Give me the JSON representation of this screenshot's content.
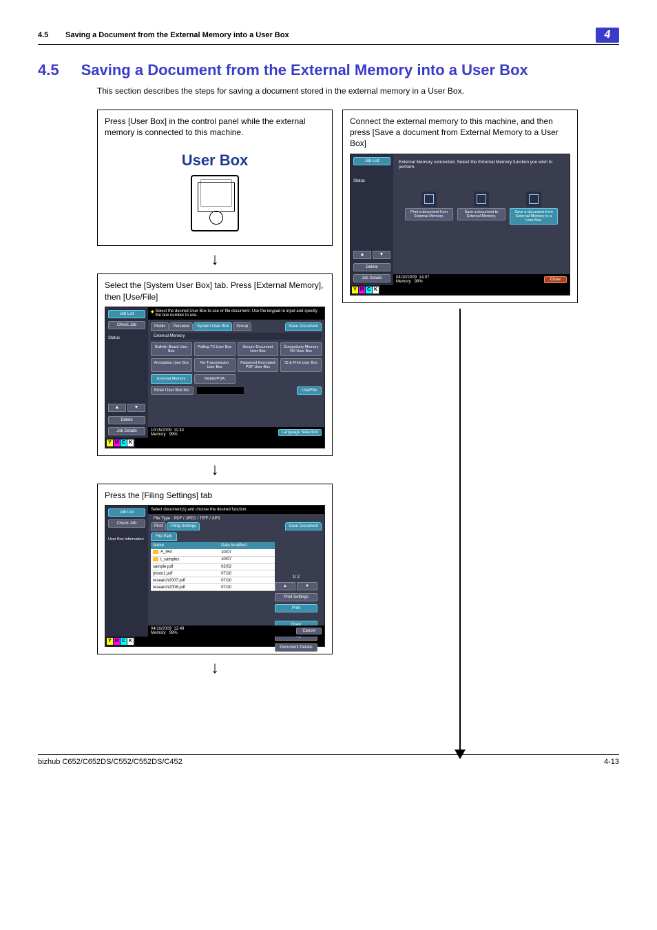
{
  "header": {
    "num": "4.5",
    "title": "Saving a Document from the External Memory into a User Box",
    "chapter": "4"
  },
  "section": {
    "num": "4.5",
    "title": "Saving a Document from the External Memory into a User Box",
    "intro": "This section describes the steps for saving a document stored in the external memory in a User Box."
  },
  "step1_left": {
    "text": "Press [User Box] in the control panel while the external memory is connected to this machine.",
    "button_label": "User Box"
  },
  "step1_right": {
    "text": "Connect the external memory to this machine, and then press [Save a document from External Memory to a User Box]",
    "screen": {
      "job_list": "Job List",
      "status": "Status",
      "msg": "External Memory connected.  Select the External Memory function you wish to perform.",
      "opts": [
        "Print a document from External Memory.",
        "Save a document to External Memory.",
        "Save a document from External Memory to a User Box."
      ],
      "delete": "Delete",
      "job_details": "Job Details",
      "date": "04/10/2009",
      "time": "14:07",
      "mem": "Memory",
      "mem_pct": "99%",
      "close": "Close"
    }
  },
  "step2": {
    "text": "Select the [System User Box] tab. Press [External Memory], then [Use/File]",
    "screen": {
      "job_list": "Job List",
      "check_job": "Check Job",
      "status": "Status",
      "hint": "Select the desired User Box to use or file document. Use the keypad to input and specify the box number to use.",
      "tabs": [
        "Public",
        "Personal",
        "System User Box",
        "Group"
      ],
      "save_doc": "Save Document",
      "subhead": "External Memory",
      "boxes": [
        "Bulletin Board User Box",
        "Polling TX User Box",
        "Secure Document User Box",
        "Compulsory Memory RX User Box",
        "Annotation User Box",
        "Re-Transmission User Box",
        "Password Encrypted PDF User Box",
        "ID & Print User Box",
        "External Memory",
        "Mobile/PDA"
      ],
      "enter": "Enter User Box No.",
      "use": "Use/File",
      "delete": "Delete",
      "job_details": "Job Details",
      "date": "10/15/2009",
      "time": "11:33",
      "mem": "Memory",
      "mem_pct": "99%",
      "lang": "Language Selection"
    }
  },
  "step3": {
    "text": "Press the [Filing Settings] tab",
    "screen": {
      "job_list": "Job List",
      "check_job": "Check Job",
      "ubi": "User Box Information",
      "hint": "Select document(s) and choose the desired function.",
      "file_type_lbl": "File Type",
      "file_type_val": ": PDF / JPEG / TIFF / XPS",
      "tabs": [
        "Print",
        "Filing Settings"
      ],
      "save_doc": "Save Document",
      "file_path": "File Path",
      "cols": [
        "Name",
        "Date Modified"
      ],
      "rows": [
        {
          "name": "A_test",
          "date": "10/07",
          "folder": true
        },
        {
          "name": "t_samples",
          "date": "10/07",
          "folder": true
        },
        {
          "name": "sample.pdf",
          "date": "02/02",
          "folder": false
        },
        {
          "name": "photo1.pdf",
          "date": "07/10",
          "folder": false
        },
        {
          "name": "research2007.pdf",
          "date": "07/10",
          "folder": false
        },
        {
          "name": "research2008.pdf",
          "date": "07/10",
          "folder": false
        }
      ],
      "page": "1/ 2",
      "right": {
        "print_settings": "Print Settings",
        "print": "Print",
        "open": "Open",
        "up": "↖ Up",
        "details": "Document Details"
      },
      "cancel": "Cancel",
      "date": "04/10/2009",
      "time": "12:49",
      "mem": "Memory",
      "mem_pct": "99%"
    }
  },
  "footer": {
    "left": "bizhub C652/C652DS/C552/C552DS/C452",
    "right": "4-13"
  }
}
